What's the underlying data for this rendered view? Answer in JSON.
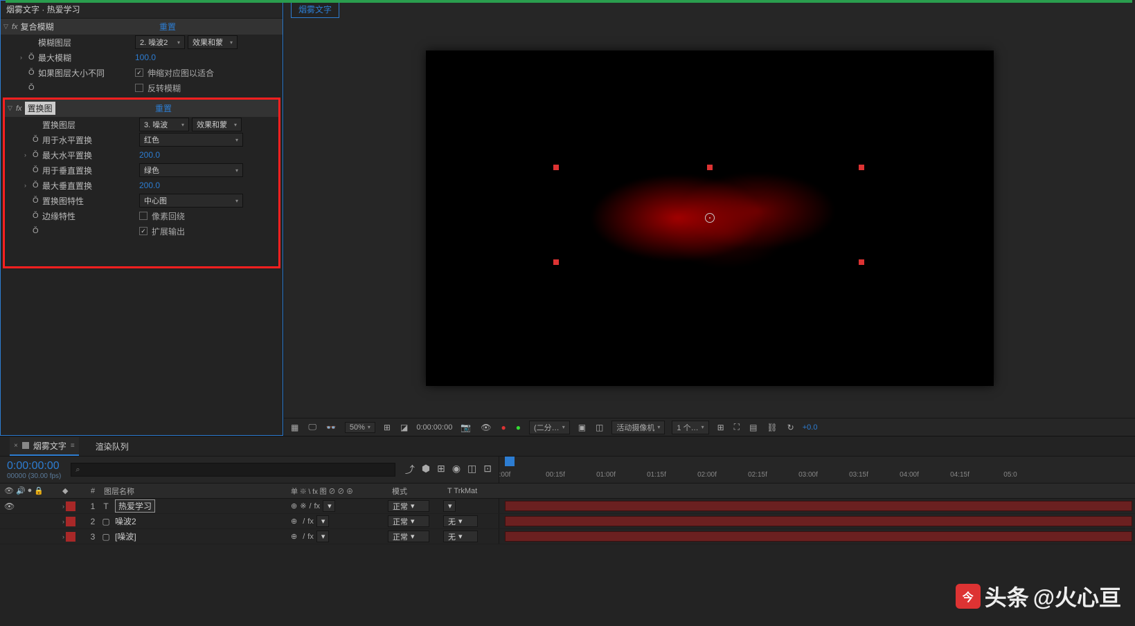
{
  "header": {
    "title": "烟雾文字 · 热爱学习"
  },
  "fx1": {
    "name": "复合模糊",
    "reset": "重置",
    "p_blurLayer": "模糊图层",
    "p_blurLayer_v1": "2. 噪波2",
    "p_blurLayer_v2": "效果和蒙",
    "p_maxBlur": "最大模糊",
    "p_maxBlur_v": "100.0",
    "p_ifDiff": "如果图层大小不同",
    "p_ifDiff_v": "伸缩对应图以适合",
    "p_invert": "反转模糊"
  },
  "fx2": {
    "name": "置换图",
    "reset": "重置",
    "p_mapLayer": "置换图层",
    "p_mapLayer_v1": "3. 噪波",
    "p_mapLayer_v2": "效果和蒙",
    "p_horizUse": "用于水平置换",
    "p_horizUse_v": "红色",
    "p_maxHoriz": "最大水平置换",
    "p_maxHoriz_v": "200.0",
    "p_vertUse": "用于垂直置换",
    "p_vertUse_v": "绿色",
    "p_maxVert": "最大垂直置换",
    "p_maxVert_v": "200.0",
    "p_behavior": "置换图特性",
    "p_behavior_v": "中心图",
    "p_edge": "边缘特性",
    "p_edge_v": "像素回绕",
    "p_expand": "扩展输出"
  },
  "comp": {
    "tab": "烟雾文字"
  },
  "viewer": {
    "zoom": "50%",
    "time": "0:00:00:00",
    "res": "(二分…",
    "camera": "活动摄像机",
    "views": "1 个…",
    "exposure": "+0.0"
  },
  "timeline": {
    "tab1": "烟雾文字",
    "tab2": "渲染队列",
    "time": "0:00:00:00",
    "fps": "00000 (30.00 fps)",
    "cols": {
      "name": "图层名称",
      "mode": "模式",
      "trkmat": "T  TrkMat",
      "switches": "单 ※ \\ fx 图 ⊘ ⊘ ⊕"
    },
    "layers": [
      {
        "num": "1",
        "type": "T",
        "name": "热爱学习",
        "mode": "正常",
        "trk": "",
        "sel": true
      },
      {
        "num": "2",
        "type": "",
        "name": "噪波2",
        "mode": "正常",
        "trk": "无"
      },
      {
        "num": "3",
        "type": "",
        "name": "[噪波]",
        "mode": "正常",
        "trk": "无"
      }
    ],
    "ticks": [
      ":00f",
      "00:15f",
      "01:00f",
      "01:15f",
      "02:00f",
      "02:15f",
      "03:00f",
      "03:15f",
      "04:00f",
      "04:15f",
      "05:0"
    ]
  },
  "watermark": {
    "brand": "头条",
    "user": "@火心亘"
  }
}
